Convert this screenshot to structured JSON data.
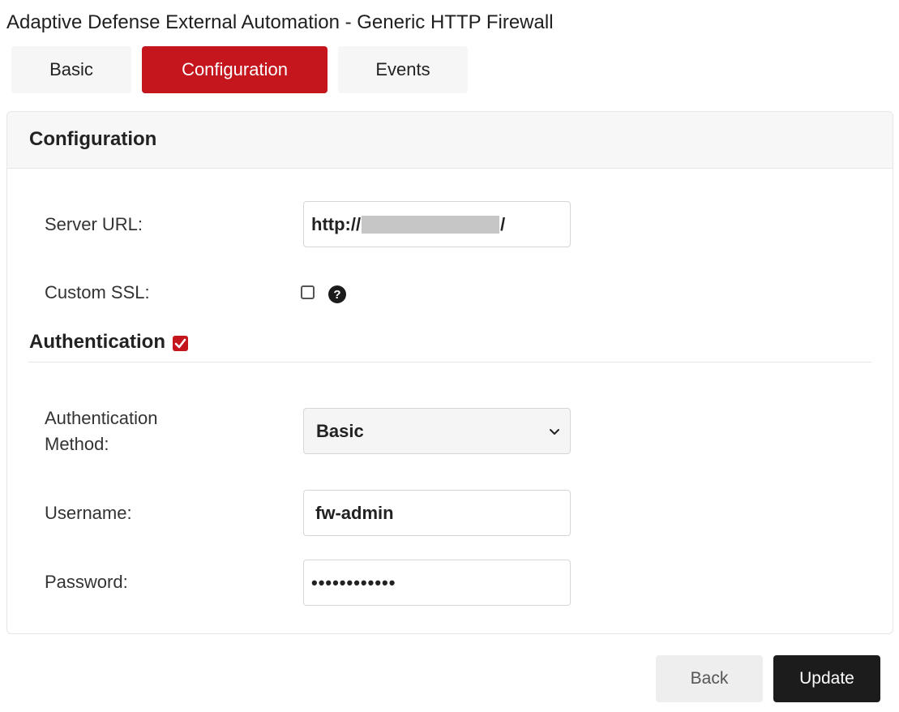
{
  "page": {
    "title": "Adaptive Defense External Automation - Generic HTTP Firewall"
  },
  "tabs": [
    {
      "label": "Basic",
      "active": false
    },
    {
      "label": "Configuration",
      "active": true
    },
    {
      "label": "Events",
      "active": false
    }
  ],
  "panel": {
    "title": "Configuration"
  },
  "server_url": {
    "label": "Server URL:",
    "prefix": "http://",
    "suffix": "/"
  },
  "custom_ssl": {
    "label": "Custom SSL:",
    "checked": false,
    "help_icon": "question-circle-icon"
  },
  "authentication": {
    "title": "Authentication",
    "enabled": true,
    "method_label_line1": "Authentication",
    "method_label_line2": "Method:",
    "method_value": "Basic",
    "username_label": "Username:",
    "username_value": "fw-admin",
    "password_label": "Password:",
    "password_value": "••••••••••••"
  },
  "actions": {
    "back_label": "Back",
    "update_label": "Update"
  },
  "colors": {
    "accent": "#c4161c",
    "dark_button": "#1c1c1c"
  }
}
